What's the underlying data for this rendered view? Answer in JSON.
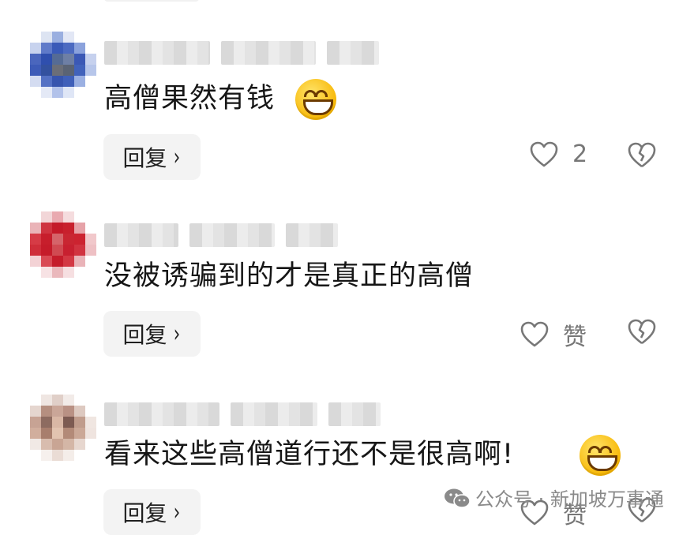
{
  "comments": [
    {
      "text": "高僧果然有钱",
      "emoji": "grinning-emoji",
      "reply_label": "回复",
      "like_value": "2"
    },
    {
      "text": "没被诱骗到的才是真正的高僧",
      "reply_label": "回复",
      "like_value": "赞"
    },
    {
      "text": "看来这些高僧道行还不是很高啊!",
      "emoji": "laughing-emoji",
      "reply_label": "回复",
      "like_value": "赞"
    }
  ],
  "reply_chevron": "›",
  "watermark": {
    "icon": "wechat-icon",
    "text": "公众号 · 新加坡万事通"
  },
  "colors": {
    "reply_bg": "#f3f3f3",
    "icon_gray": "#777777",
    "emoji_yellow": "#f7b500"
  }
}
